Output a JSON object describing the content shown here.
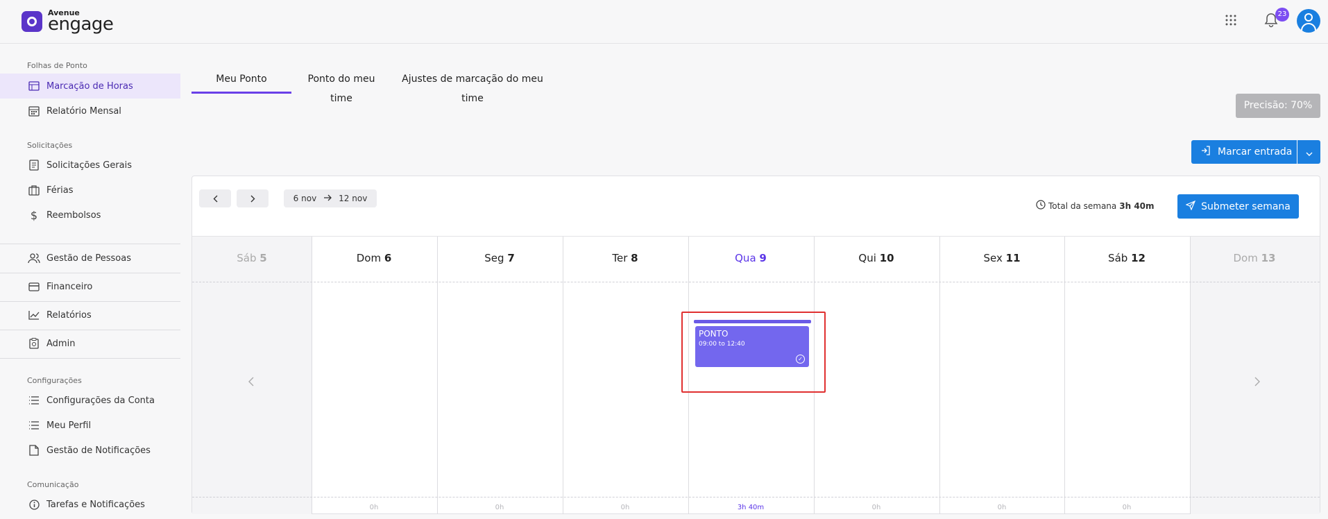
{
  "header": {
    "logo_top": "Avenue",
    "logo_main": "engage",
    "notification_count": "23",
    "icons": [
      "apps-grid-icon",
      "bell-icon",
      "user-avatar-icon"
    ]
  },
  "sidebar": {
    "sections": [
      {
        "title": "Folhas de Ponto",
        "items": [
          {
            "label": "Marcação de Horas",
            "icon": "timesheet-icon",
            "active": true
          },
          {
            "label": "Relatório Mensal",
            "icon": "calendar-icon",
            "active": false
          }
        ]
      },
      {
        "title": "Solicitações",
        "items": [
          {
            "label": "Solicitações Gerais",
            "icon": "request-icon"
          },
          {
            "label": "Férias",
            "icon": "suitcase-icon"
          },
          {
            "label": "Reembolsos",
            "icon": "dollar-icon"
          }
        ]
      },
      {
        "title": "",
        "items": [
          {
            "label": "Gestão de Pessoas",
            "icon": "people-icon"
          },
          {
            "label": "Financeiro",
            "icon": "credit-card-icon"
          },
          {
            "label": "Relatórios",
            "icon": "chart-line-icon"
          },
          {
            "label": "Admin",
            "icon": "clipboard-icon"
          }
        ]
      },
      {
        "title": "Configurações",
        "items": [
          {
            "label": "Configurações da Conta",
            "icon": "list-icon"
          },
          {
            "label": "Meu Perfil",
            "icon": "list-icon"
          },
          {
            "label": "Gestão de Notificações",
            "icon": "document-icon"
          }
        ]
      },
      {
        "title": "Comunicação",
        "items": [
          {
            "label": "Tarefas e Notificações",
            "icon": "info-icon"
          }
        ]
      }
    ]
  },
  "tabs": [
    {
      "label": "Meu Ponto",
      "active": true
    },
    {
      "label": "Ponto do meu time",
      "active": false
    },
    {
      "label": "Ajustes de marcação do meu time",
      "active": false
    }
  ],
  "precision_label": "Precisão: 70%",
  "clock_in_button": "Marcar entrada",
  "calendar": {
    "range_start": "6 nov",
    "range_end": "12 nov",
    "total_label": "Total da semana",
    "total_value": "3h 40m",
    "submit_button": "Submeter semana",
    "days": [
      {
        "name": "Sáb",
        "num": "5",
        "state": "outside",
        "total": ""
      },
      {
        "name": "Dom",
        "num": "6",
        "state": "normal",
        "total": "0h"
      },
      {
        "name": "Seg",
        "num": "7",
        "state": "normal",
        "total": "0h"
      },
      {
        "name": "Ter",
        "num": "8",
        "state": "normal",
        "total": "0h"
      },
      {
        "name": "Qua",
        "num": "9",
        "state": "today",
        "total": "3h 40m"
      },
      {
        "name": "Qui",
        "num": "10",
        "state": "normal",
        "total": "0h"
      },
      {
        "name": "Sex",
        "num": "11",
        "state": "normal",
        "total": "0h"
      },
      {
        "name": "Sáb",
        "num": "12",
        "state": "normal",
        "total": "0h"
      },
      {
        "name": "Dom",
        "num": "13",
        "state": "outside",
        "total": ""
      }
    ],
    "event": {
      "title": "PONTO",
      "time": "09:00 to 12:40"
    }
  },
  "colors": {
    "accent": "#6a40e8",
    "primary_button": "#1a7fe0",
    "event": "#7367ee",
    "highlight": "#e03030"
  }
}
